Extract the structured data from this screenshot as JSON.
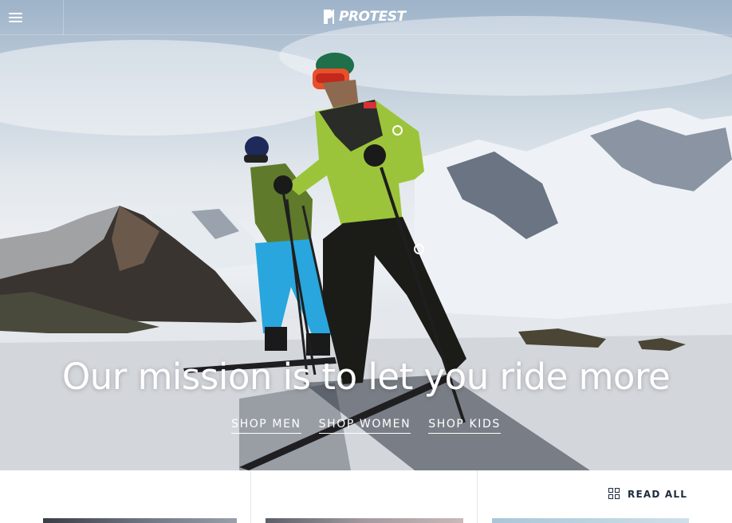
{
  "header": {
    "menu_icon": "hamburger-menu-icon",
    "logo_text": "PROTEST",
    "logo_icon": "protest-p-logo-icon"
  },
  "hero": {
    "headline": "Our mission is to let you ride more",
    "links": [
      {
        "label": "SHOP MEN"
      },
      {
        "label": "SHOP WOMEN"
      },
      {
        "label": "SHOP KIDS"
      }
    ],
    "hotspot_icon": "hotspot-circle-icon"
  },
  "content_strip": {
    "read_all_label": "READ ALL",
    "read_all_icon": "grid-icon"
  },
  "colors": {
    "text_light": "#ffffff",
    "navy": "#1d2a3e",
    "divider": "#e3e5e8"
  }
}
